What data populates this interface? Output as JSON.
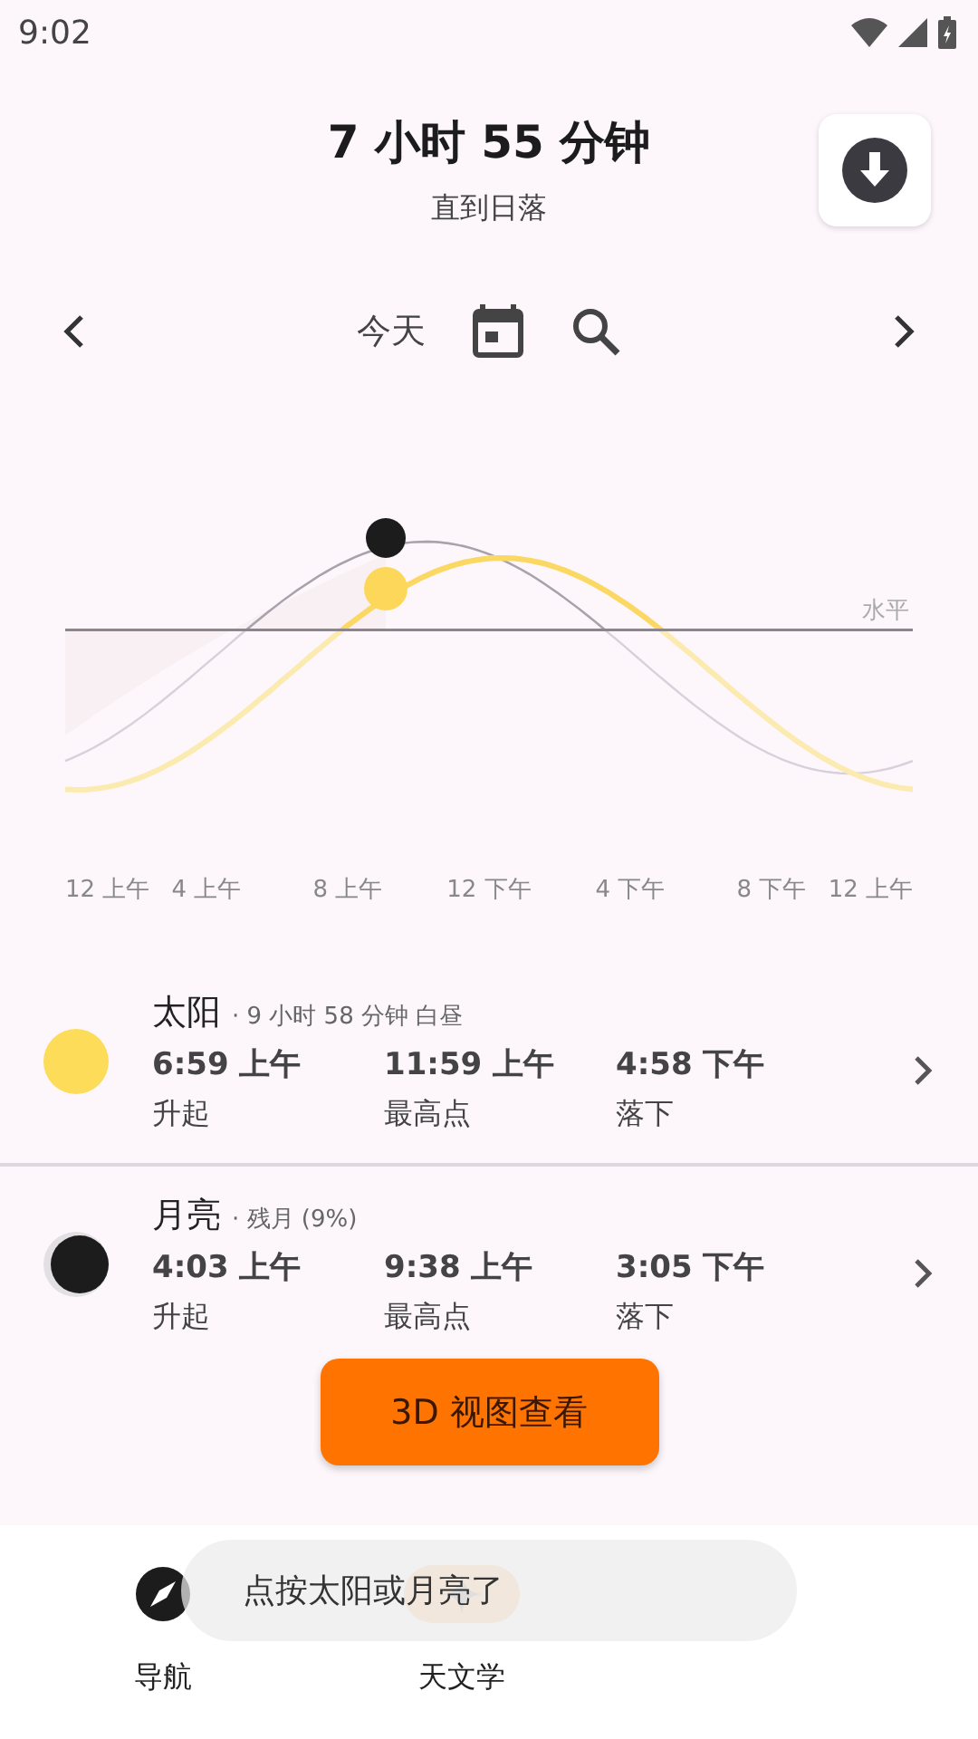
{
  "status_bar": {
    "time": "9:02"
  },
  "header": {
    "title": "7 小时 55 分钟",
    "subtitle": "直到日落"
  },
  "date_nav": {
    "label": "今天"
  },
  "chart": {
    "horizon_label": "水平",
    "x_labels": [
      "12 上午",
      "4 上午",
      "8 上午",
      "12 下午",
      "4 下午",
      "8 下午",
      "12 上午"
    ]
  },
  "bodies": [
    {
      "kind": "sun",
      "name": "太阳",
      "detail": "· 9 小时 58 分钟 白昼",
      "events": [
        {
          "time": "6:59 上午",
          "label": "升起"
        },
        {
          "time": "11:59 上午",
          "label": "最高点"
        },
        {
          "time": "4:58 下午",
          "label": "落下"
        }
      ]
    },
    {
      "kind": "moon",
      "name": "月亮",
      "detail": "· 残月 (9%)",
      "events": [
        {
          "time": "4:03 上午",
          "label": "升起"
        },
        {
          "time": "9:38 上午",
          "label": "最高点"
        },
        {
          "time": "3:05 下午",
          "label": "落下"
        }
      ]
    }
  ],
  "action_button": "3D 视图查看",
  "bottom_nav": [
    {
      "kind": "compass",
      "label": "导航",
      "selected": false
    },
    {
      "kind": "star",
      "label": "天文学",
      "selected": true
    }
  ],
  "toast": "点按太阳或月亮了"
}
